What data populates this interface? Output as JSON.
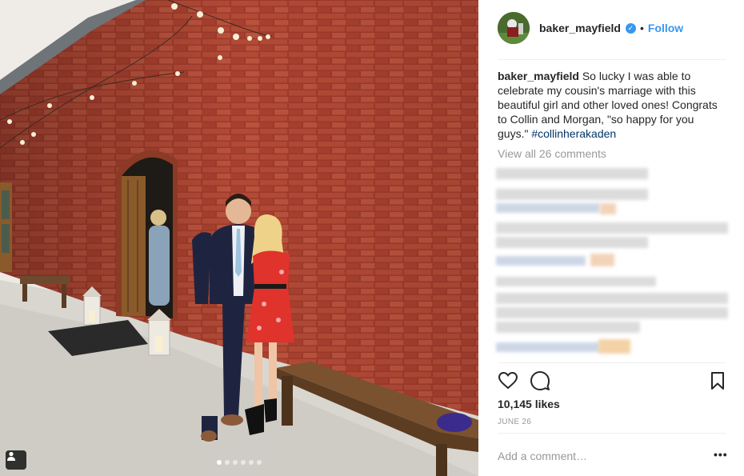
{
  "post": {
    "username": "baker_mayfield",
    "separator": "•",
    "follow_label": "Follow",
    "caption_username": "baker_mayfield",
    "caption_text": " So lucky I was able to celebrate my cousin's marriage with this beautiful girl and other loved ones! Congrats to Collin and Morgan, \"so happy for you guys.\" ",
    "hashtag": "#collinherakaden",
    "view_all_comments": "View all 26 comments",
    "likes": "10,145 likes",
    "date": "JUNE 26",
    "comment_placeholder": "Add a comment…",
    "more_label": "•••",
    "carousel": {
      "count": 6,
      "active_index": 0
    }
  },
  "icons": {
    "verified": "verified-check-icon",
    "like": "heart-icon",
    "comment": "speech-bubble-icon",
    "save": "bookmark-icon",
    "tag": "person-tag-icon"
  },
  "colors": {
    "accent": "#3897f0",
    "hashtag": "#003569",
    "muted": "#999999",
    "brick": "#a84131",
    "dress": "#e0332b"
  }
}
